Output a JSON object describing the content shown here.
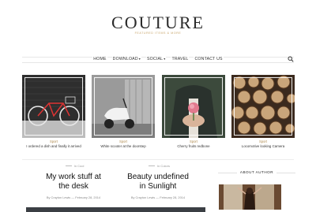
{
  "site": {
    "logo": "COUTURE",
    "tagline": "FEATURED ITEMS & MORE"
  },
  "nav": {
    "items": [
      {
        "label": "HOME",
        "dropdown": false
      },
      {
        "label": "DOWNLOAD",
        "dropdown": true
      },
      {
        "label": "SOCIAL",
        "dropdown": true
      },
      {
        "label": "TRAVEL",
        "dropdown": false
      },
      {
        "label": "CONTACT US",
        "dropdown": false
      }
    ],
    "search_icon": "search-icon"
  },
  "featured": [
    {
      "category": "Sport",
      "title": "I ordered a dish and finally it arrived"
    },
    {
      "category": "Sport",
      "title": "White scooter at the doorstep"
    },
    {
      "category": "Sport",
      "title": "Cherry fruits redbone"
    },
    {
      "category": "Sport",
      "title": "Locomotive looking Camera"
    }
  ],
  "posts": [
    {
      "category": "In Cool",
      "title_line1": "My work stuff at",
      "title_line2": "the desk",
      "author": "By Crayton Lewis",
      "date": "February 28, 2014"
    },
    {
      "category": "In Colors",
      "title_line1": "Beauty undefined",
      "title_line2": "in Sunlight",
      "author": "By Crayton Lewis",
      "date": "February 28, 2014"
    }
  ],
  "sidebar": {
    "about_title": "ABOUT AUTHOR"
  },
  "colors": {
    "accent": "#c9a66b",
    "text": "#222222",
    "muted": "#888888"
  }
}
